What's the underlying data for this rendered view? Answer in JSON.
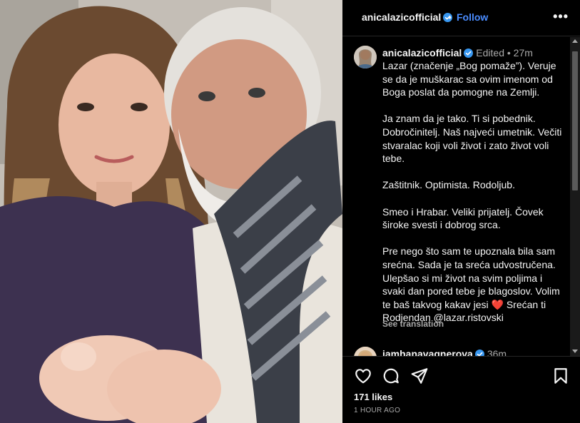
{
  "post": {
    "author": "anicalazicofficial",
    "follow_label": "Follow",
    "header_separator": "•",
    "more_label": "•••",
    "caption": {
      "username": "anicalazicofficial",
      "meta": "Edited  •  27m",
      "text": "Lazar (značenje „Bog pomaže”). Veruje se da je muškarac sa ovim imenom od Boga poslat da pomogne na Zemlji.\n\nJa znam da je tako. Ti si pobednik. Dobročinitelj. Naš najveći umetnik. Večiti stvaralac koji voli život i zato život voli tebe.\n\nZaštitnik. Optimista. Rodoljub.\n\nSmeo i Hrabar. Veliki prijatelj. Čovek široke svesti i dobrog srca.\n\nPre nego što sam te upoznala bila sam srećna. Sada je ta sreća udvostručena. Ulepšao si mi život na svim poljima i svaki dan pored tebe je blagoslov. Volim te baš takvog kakav jesi ❤️ Srećan ti Rodjendan @lazar.ristovski",
      "see_translation": "See translation"
    },
    "comment": {
      "username": "iamhanavagnerova",
      "meta": "36m"
    },
    "likes": "171 likes",
    "time_ago": "1 HOUR AGO"
  },
  "icons": {
    "verified": "verified-badge-icon",
    "like": "heart-icon",
    "comment": "comment-bubble-icon",
    "share": "paper-plane-icon",
    "save": "bookmark-icon",
    "more": "more-options-icon"
  },
  "colors": {
    "background": "#000000",
    "accent_link": "#4a8cff",
    "verified": "#3897f0",
    "secondary_text": "#a8a8a8"
  }
}
